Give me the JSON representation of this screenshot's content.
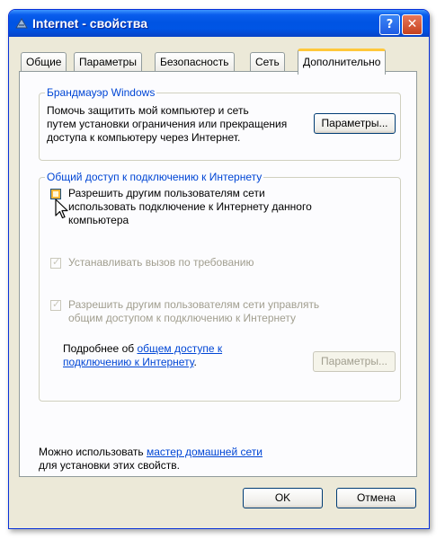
{
  "window": {
    "title": "Internet - свойства",
    "help_button": "?",
    "close_button": "✕"
  },
  "tabs": [
    {
      "label": "Общие"
    },
    {
      "label": "Параметры"
    },
    {
      "label": "Безопасность"
    },
    {
      "label": "Сеть"
    },
    {
      "label": "Дополнительно",
      "active": true
    }
  ],
  "firewall": {
    "title": "Брандмауэр Windows",
    "description_lines": [
      "Помочь защитить мой компьютер и сеть",
      "путем установки ограничения или прекращения",
      "доступа к компьютеру через Интернет."
    ],
    "settings_button": "Параметры..."
  },
  "ics": {
    "title": "Общий доступ к подключению к Интернету",
    "allow_sharing": {
      "checked": false,
      "label_lines": [
        "Разрешить другим пользователям сети",
        "использовать подключение к Интернету данного",
        "компьютера"
      ]
    },
    "dial_on_demand": {
      "checked": true,
      "enabled": false,
      "label": "Устанавливать вызов по требованию"
    },
    "allow_control": {
      "checked": true,
      "enabled": false,
      "label_lines": [
        "Разрешить другим пользователям сети управлять",
        "общим доступом к подключению к Интернету"
      ]
    },
    "more_info_prefix": "Подробнее об",
    "more_info_link_line1": "общем доступе к",
    "more_info_link_line2": "подключению к Интернету",
    "more_info_suffix": ".",
    "settings_button": "Параметры..."
  },
  "footer": {
    "prefix": "Можно использовать",
    "link": "мастер домашней сети",
    "line2": "для установки этих свойств."
  },
  "buttons": {
    "ok": "OK",
    "cancel": "Отмена"
  },
  "icons": {
    "window_icon": "network-icon",
    "cursor": "arrow-cursor-icon",
    "check": "✓"
  }
}
